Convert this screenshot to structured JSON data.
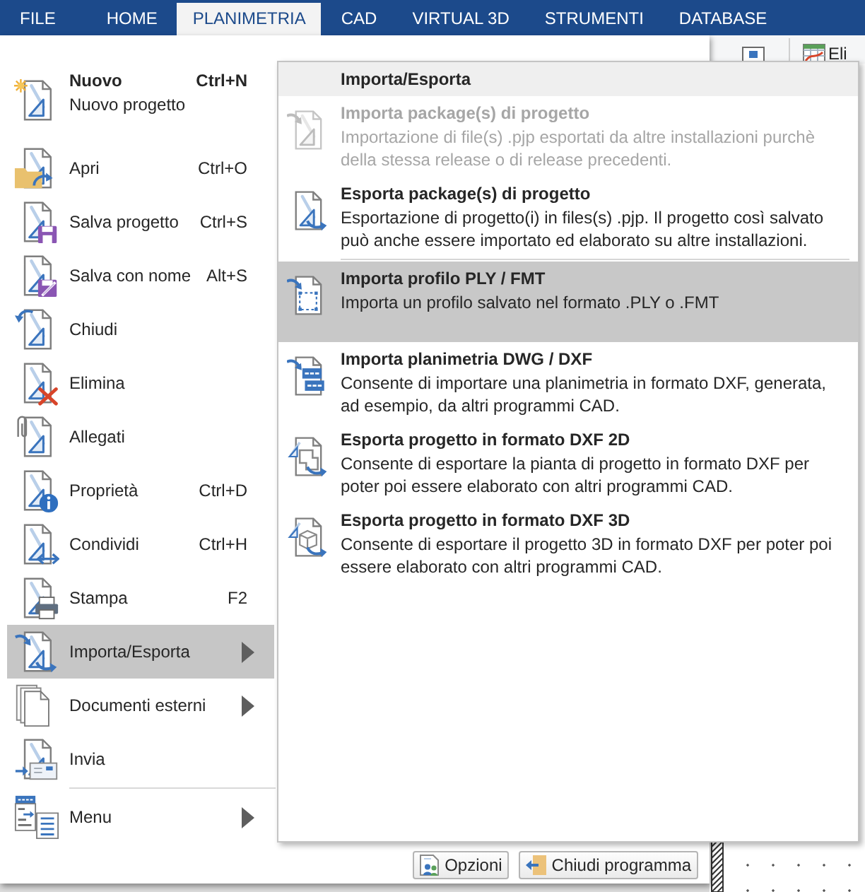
{
  "tabs": [
    {
      "label": "FILE",
      "selected": false
    },
    {
      "label": "HOME",
      "selected": false
    },
    {
      "label": "PLANIMETRIA",
      "selected": true
    },
    {
      "label": "CAD",
      "selected": false
    },
    {
      "label": "VIRTUAL 3D",
      "selected": false
    },
    {
      "label": "STRUMENTI",
      "selected": false
    },
    {
      "label": "DATABASE",
      "selected": false
    }
  ],
  "ribbon": {
    "button_label": "Eli"
  },
  "file_menu": {
    "sections": [
      {
        "items": [
          {
            "label": "Nuovo",
            "description": "Nuovo progetto",
            "shortcut": "Ctrl+N",
            "selected": false,
            "submenu": false
          },
          {
            "label": "Apri",
            "shortcut": "Ctrl+O",
            "selected": false,
            "submenu": false
          },
          {
            "label": "Salva progetto",
            "shortcut": "Ctrl+S",
            "selected": false,
            "submenu": false
          },
          {
            "label": "Salva con nome",
            "shortcut": "Alt+S",
            "selected": false,
            "submenu": false
          },
          {
            "label": "Chiudi",
            "selected": false,
            "submenu": false
          },
          {
            "label": "Elimina",
            "selected": false,
            "submenu": false
          },
          {
            "label": "Allegati",
            "selected": false,
            "submenu": false
          },
          {
            "label": "Proprietà",
            "shortcut": "Ctrl+D",
            "selected": false,
            "submenu": false
          },
          {
            "label": "Condividi",
            "shortcut": "Ctrl+H",
            "selected": false,
            "submenu": false
          },
          {
            "label": "Stampa",
            "shortcut": "F2",
            "selected": false,
            "submenu": false
          },
          {
            "label": "Importa/Esporta",
            "selected": true,
            "submenu": true
          },
          {
            "label": "Documenti esterni",
            "selected": false,
            "submenu": true
          },
          {
            "label": "Invia",
            "selected": false,
            "submenu": false
          }
        ]
      },
      {
        "items": [
          {
            "label": "Menu",
            "selected": false,
            "submenu": true
          }
        ]
      }
    ]
  },
  "submenu": {
    "title": "Importa/Esporta",
    "sections": [
      {
        "items": [
          {
            "title": "Importa package(s) di progetto",
            "description": "Importazione di file(s) .pjp esportati da altre installazioni purchè\ndella stessa release o di release precedenti.",
            "disabled": true,
            "selected": false
          },
          {
            "title": "Esporta package(s) di progetto",
            "description": "Esportazione di progetto(i) in files(s) .pjp. Il progetto così salvato\npuò anche essere importato ed elaborato su altre installazioni.",
            "disabled": false,
            "selected": false
          }
        ]
      },
      {
        "items": [
          {
            "title": "Importa profilo PLY / FMT",
            "description": "Importa un profilo salvato nel formato .PLY o .FMT",
            "disabled": false,
            "selected": true
          },
          {
            "title": "Importa planimetria DWG / DXF",
            "description": "Consente di importare una planimetria in formato DXF, generata,\nad esempio, da altri programmi CAD.",
            "disabled": false,
            "selected": false
          },
          {
            "title": "Esporta progetto in formato DXF 2D",
            "description": "Consente di esportare la pianta di progetto in formato DXF per\npoter poi essere elaborato con altri programmi CAD.",
            "disabled": false,
            "selected": false
          },
          {
            "title": "Esporta progetto in formato DXF 3D",
            "description": "Consente di esportare il progetto 3D in formato DXF per poter poi\nessere elaborato con altri programmi CAD.",
            "disabled": false,
            "selected": false
          }
        ]
      }
    ]
  },
  "footer_buttons": [
    {
      "label": "Opzioni"
    },
    {
      "label": "Chiudi programma"
    }
  ]
}
